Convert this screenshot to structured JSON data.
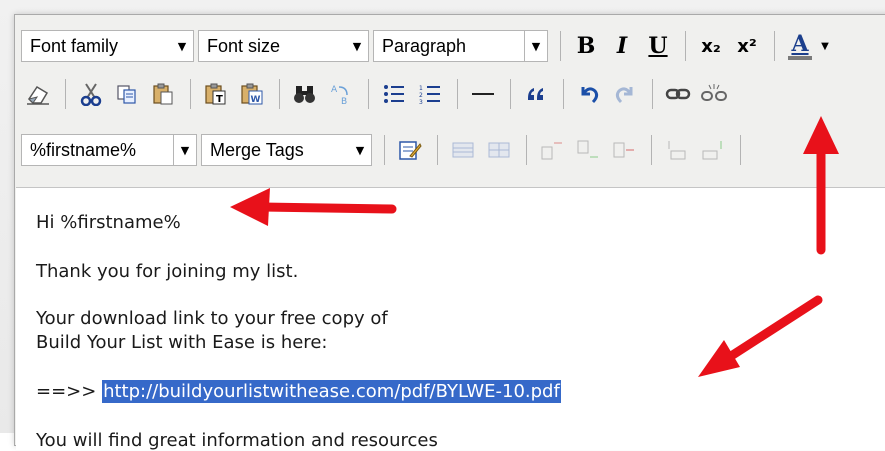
{
  "toolbar": {
    "font_family": "Font family",
    "font_size": "Font size",
    "paragraph": "Paragraph",
    "bold": "B",
    "italic": "I",
    "underline": "U",
    "subscript": "x₂",
    "superscript": "x²",
    "text_color": "A",
    "merge_field": "%firstname%",
    "merge_tags": "Merge Tags"
  },
  "content": {
    "greeting": "Hi %firstname%",
    "line_thanks": "Thank you for joining my list.",
    "line_download_1": "Your download link to your free copy of",
    "line_download_2": "Build Your List with Ease is here:",
    "link_prefix": "==>>",
    "link_url": "http://buildyourlistwithease.com/pdf/BYLWE-10.pdf",
    "line_info": "You will find great information and resources"
  },
  "colors": {
    "annotation_arrow": "#e8111a",
    "selection": "#3669c9"
  }
}
